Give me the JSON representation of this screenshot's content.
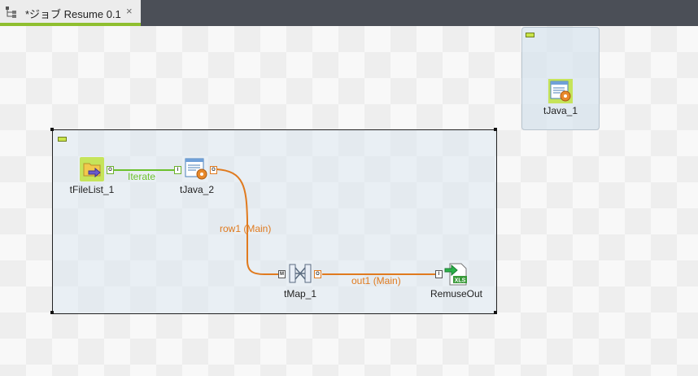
{
  "tab": {
    "title": "*ジョブ Resume 0.1",
    "close": "×"
  },
  "components": {
    "tFileList_1": "tFileList_1",
    "tJava_2": "tJava_2",
    "tMap_1": "tMap_1",
    "RemuseOut": "RemuseOut",
    "tJava_1": "tJava_1"
  },
  "links": {
    "iterate": "Iterate",
    "row1": "row1 (Main)",
    "out1": "out1 (Main)"
  },
  "colors": {
    "iterate": "#6cc12d",
    "main": "#e07a1e",
    "accent": "#8fbf2f"
  },
  "icons": {
    "tab": "job-diagram-icon",
    "tFileList_1": "folder-list-icon",
    "tJava_2": "java-gear-icon",
    "tMap_1": "tmap-icon",
    "RemuseOut": "xls-output-icon",
    "tJava_1": "java-gear-icon"
  }
}
